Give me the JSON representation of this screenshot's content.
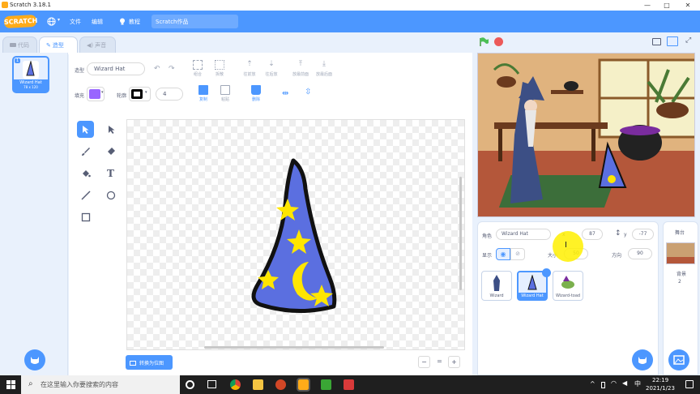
{
  "window": {
    "title": "Scratch 3.18.1",
    "min": "—",
    "max": "□",
    "close": "✕"
  },
  "menu": {
    "logo": "SCRATCH",
    "file": "文件",
    "edit": "编辑",
    "tutorials": "教程",
    "project_title": "Scratch作品"
  },
  "tabs": {
    "code": "代码",
    "costumes": "造型",
    "sounds": "声音"
  },
  "costume_list": [
    {
      "number": "1",
      "name": "Wizard Hat",
      "size": "78 x 120"
    }
  ],
  "editor": {
    "costume_label": "造型",
    "costume_name": "Wizard Hat",
    "group_label": "组合",
    "ungroup_label": "拆散",
    "forward_label": "往前放",
    "backward_label": "往后放",
    "front_label": "放最前面",
    "back_label": "放最后面",
    "fill_label": "填充",
    "outline_label": "轮廓",
    "outline_width": "4",
    "copy_label": "复制",
    "paste_label": "粘贴",
    "delete_label": "删除",
    "fill_color": "#9966ff",
    "outline_color": "#000000",
    "convert_bitmap": "转换为位图",
    "zoom_out": "−",
    "zoom_reset": "=",
    "zoom_in": "+"
  },
  "sprite_info": {
    "sprite_label": "角色",
    "sprite_name": "Wizard Hat",
    "x_label": "x",
    "x_value": "87",
    "y_label": "y",
    "y_value": "-77",
    "show_label": "显示",
    "size_label": "大小",
    "size_value": "50",
    "direction_label": "方向",
    "direction_value": "90"
  },
  "sprites": [
    {
      "name": "Wizard"
    },
    {
      "name": "Wizard Hat"
    },
    {
      "name": "Wizard-toad"
    }
  ],
  "stage_pane": {
    "label": "舞台",
    "backdrop_label": "背景",
    "backdrop_count": "2"
  },
  "taskbar": {
    "search_placeholder": "在这里输入你要搜索的内容",
    "time": "22:19",
    "date": "2021/1/23"
  },
  "colors": {
    "accent": "#4c97ff",
    "menubar": "#4c97ff",
    "hat_blue": "#5b6fe0",
    "star_yellow": "#ffe600"
  }
}
